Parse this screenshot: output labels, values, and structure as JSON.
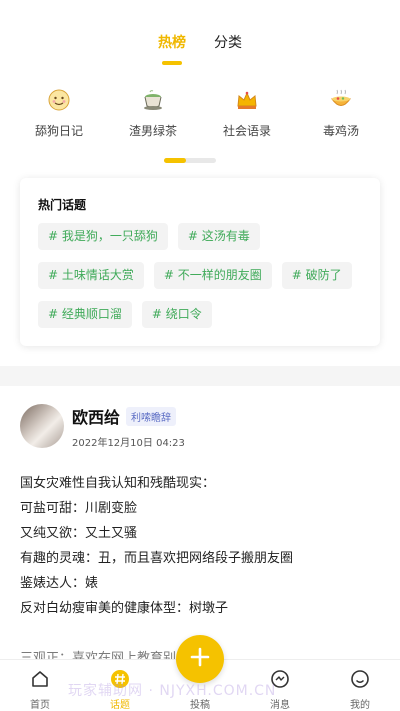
{
  "tabs": [
    {
      "label": "热榜",
      "active": true
    },
    {
      "label": "分类",
      "active": false
    }
  ],
  "categories": [
    {
      "label": "舔狗日记",
      "icon": "smiling-face-icon"
    },
    {
      "label": "渣男绿茶",
      "icon": "tea-cup-icon"
    },
    {
      "label": "社会语录",
      "icon": "crown-icon"
    },
    {
      "label": "毒鸡汤",
      "icon": "soup-bowl-icon"
    }
  ],
  "pager": {
    "current_fraction": 0.42
  },
  "hot_topics": {
    "title": "热门话题",
    "tags": [
      "#  我是狗，一只舔狗",
      "#  这汤有毒",
      "#  土味情话大赏",
      "#  不一样的朋友圈",
      "#  破防了",
      "#  经典顺口溜",
      "#  绕口令"
    ]
  },
  "post": {
    "author": "欧西给",
    "badge": "利嗦瞻辞",
    "date": "2022年12月10日 04:23",
    "lines": [
      "国女灾难性自我认知和残酷现实：",
      "可盐可甜：川剧变脸",
      "又纯又欲：又土又骚",
      "有趣的灵魂：丑，而且喜欢把网络段子搬朋友圈",
      "鉴婊达人：婊",
      "反对白幼瘦审美的健康体型：树墩子",
      "",
      "三观正：喜欢在网上教育别人"
    ]
  },
  "nav": [
    {
      "label": "首页",
      "icon": "home-icon",
      "active": false
    },
    {
      "label": "话题",
      "icon": "topic-hash-icon",
      "active": true
    },
    {
      "label": "投稿",
      "icon": "",
      "active": false
    },
    {
      "label": "消息",
      "icon": "message-icon",
      "active": false
    },
    {
      "label": "我的",
      "icon": "profile-icon",
      "active": false
    }
  ],
  "fab": {
    "icon": "plus-icon"
  },
  "watermark": "玩家辅助网 · NJYXH.COM.CN",
  "colors": {
    "accent": "#f5c200",
    "tag_text": "#3faa59",
    "badge_text": "#5b6cc4"
  }
}
